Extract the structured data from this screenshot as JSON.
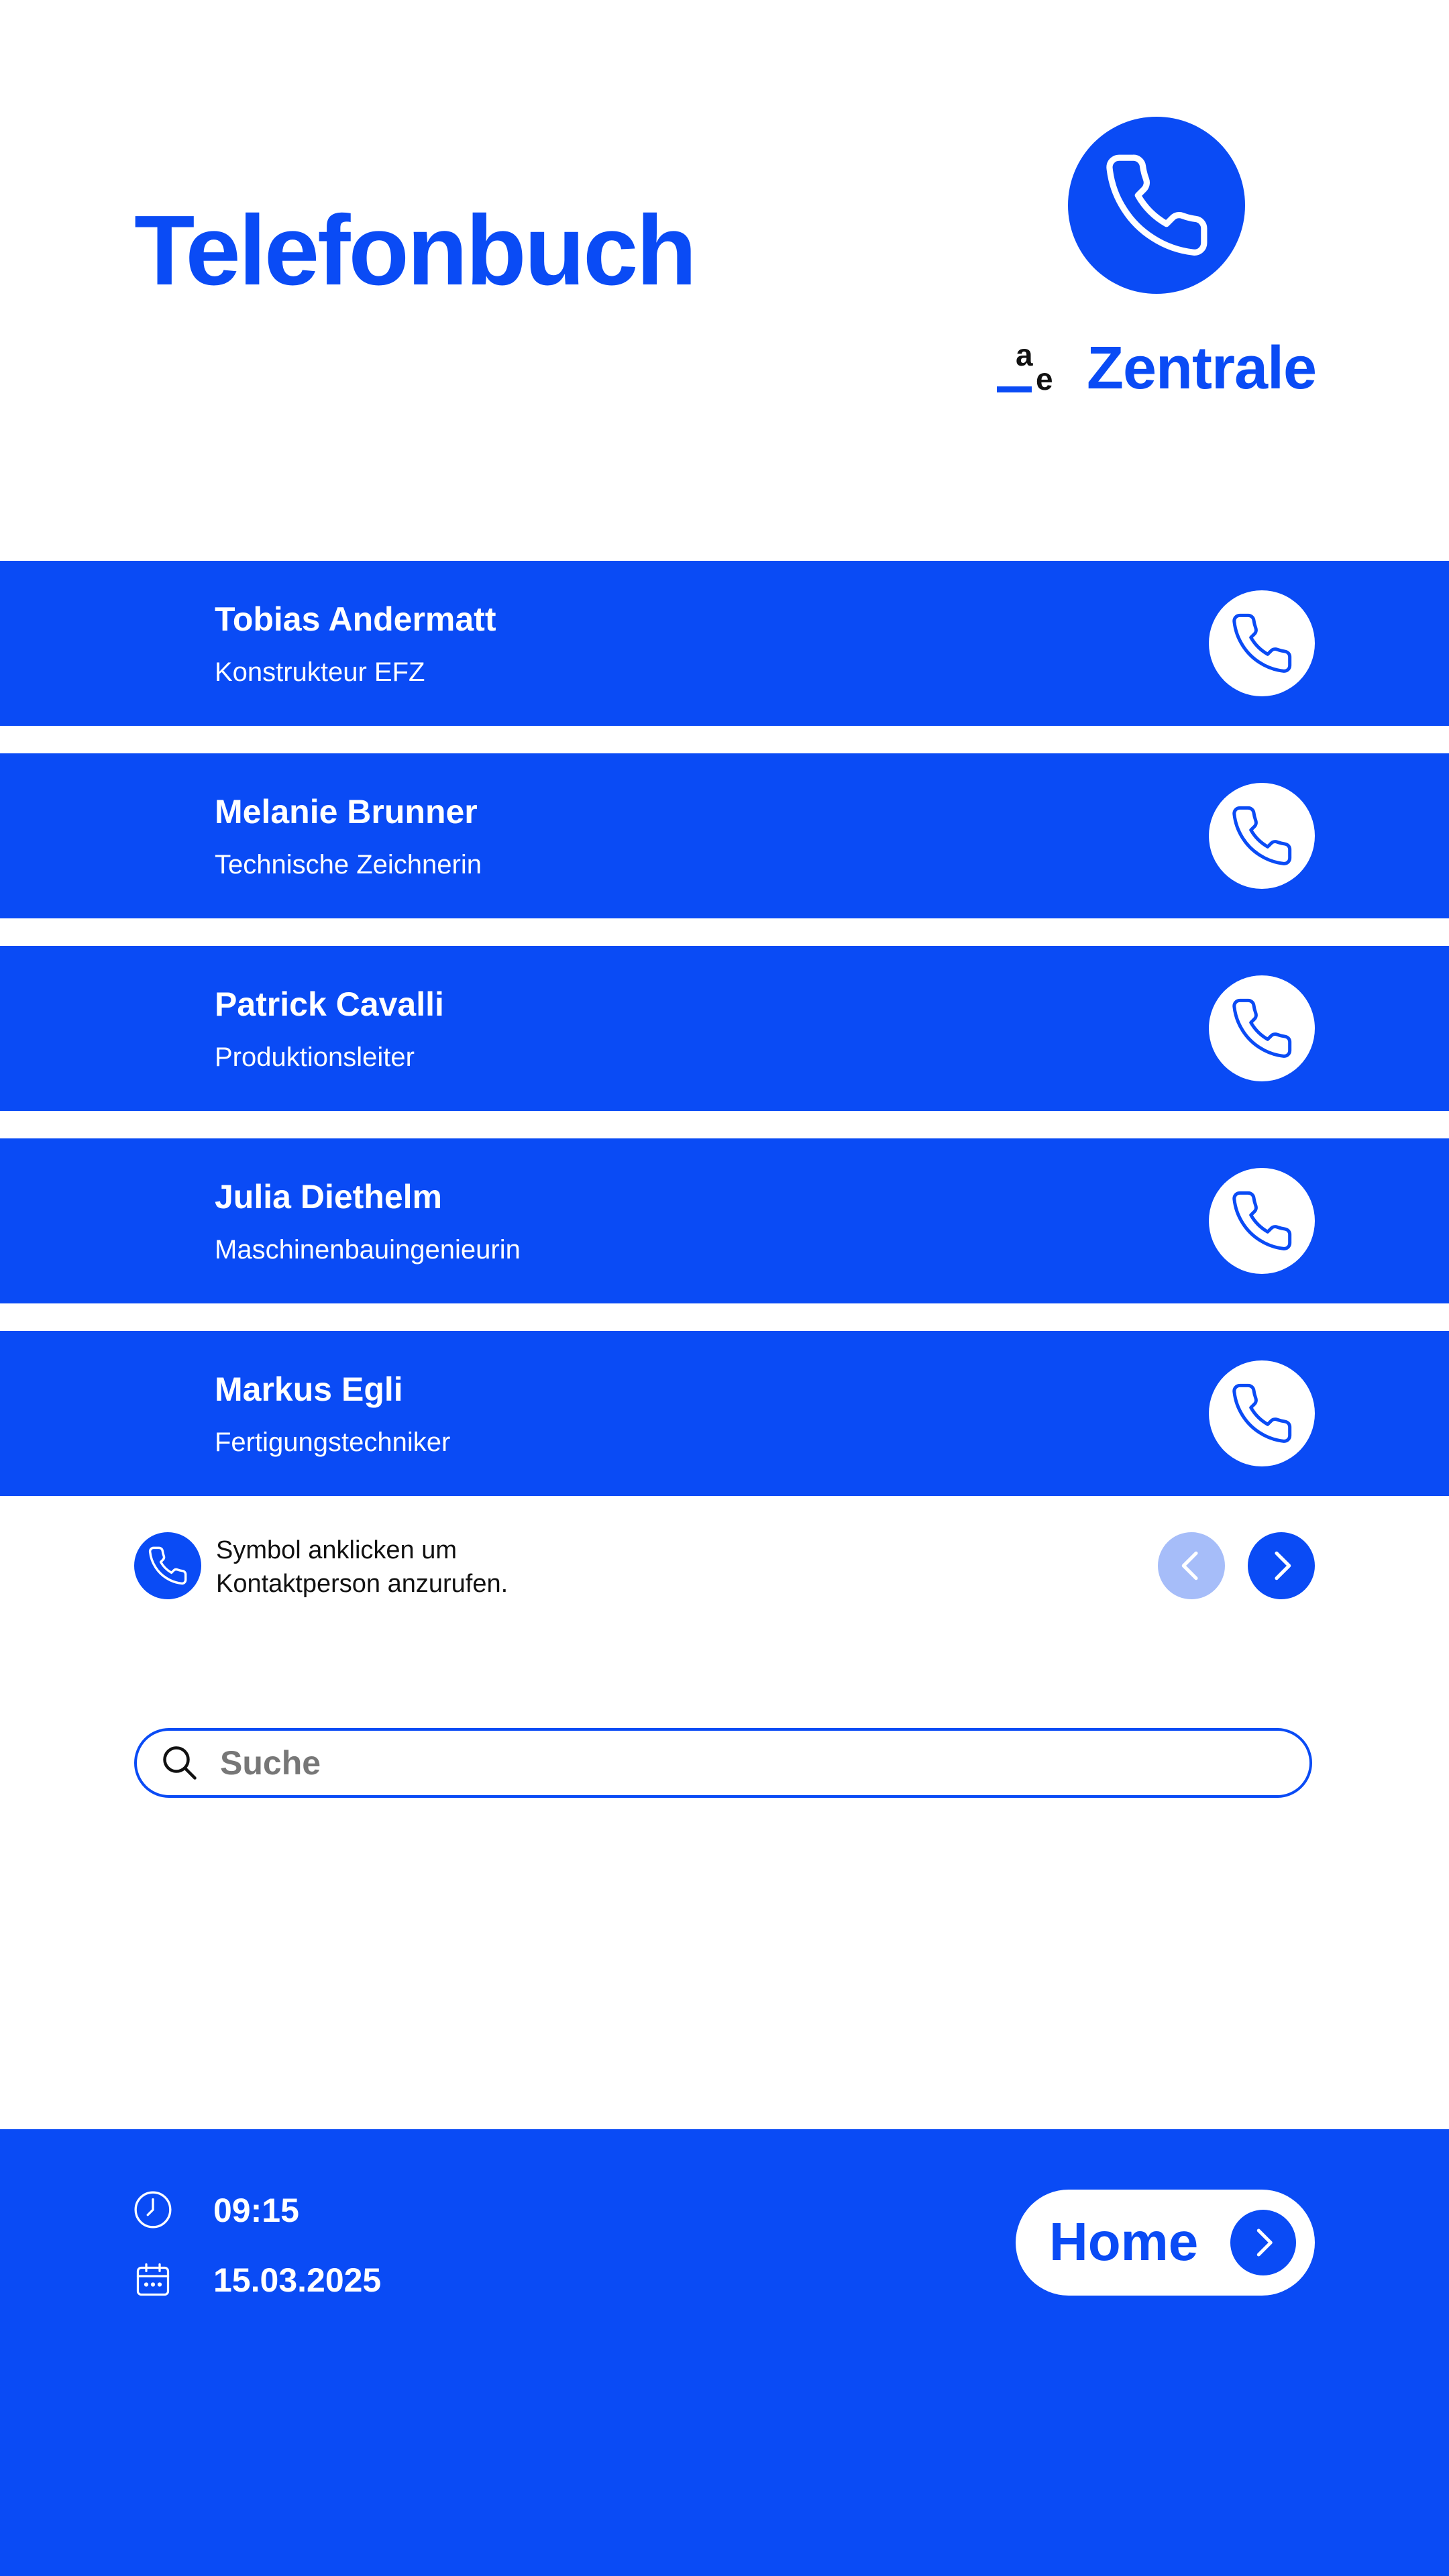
{
  "header": {
    "title": "Telefonbuch",
    "central_label": "Zentrale",
    "logo_letters": [
      "a",
      "e"
    ]
  },
  "contacts": [
    {
      "name": "Tobias Andermatt",
      "role": "Konstrukteur EFZ"
    },
    {
      "name": "Melanie Brunner",
      "role": "Technische Zeichnerin"
    },
    {
      "name": "Patrick Cavalli",
      "role": "Produktionsleiter"
    },
    {
      "name": "Julia Diethelm",
      "role": "Maschinenbauingenieurin"
    },
    {
      "name": "Markus Egli",
      "role": "Fertigungstechniker"
    }
  ],
  "hint": {
    "line1": "Symbol anklicken um",
    "line2": "Kontaktperson anzurufen."
  },
  "search": {
    "placeholder": "Suche",
    "value": ""
  },
  "footer": {
    "time": "09:15",
    "date": "15.03.2025",
    "home_label": "Home"
  },
  "colors": {
    "accent": "#0a4bf5",
    "accent_light": "#a6bdf9",
    "background": "#ffffff"
  },
  "icons": {
    "central": "phone-icon",
    "contact_call": "phone-icon",
    "search": "search-icon",
    "time": "clock-icon",
    "date": "calendar-icon",
    "prev": "chevron-left-icon",
    "next": "chevron-right-icon",
    "home": "chevron-right-icon"
  },
  "pagination": {
    "prev_enabled": false,
    "next_enabled": true
  }
}
